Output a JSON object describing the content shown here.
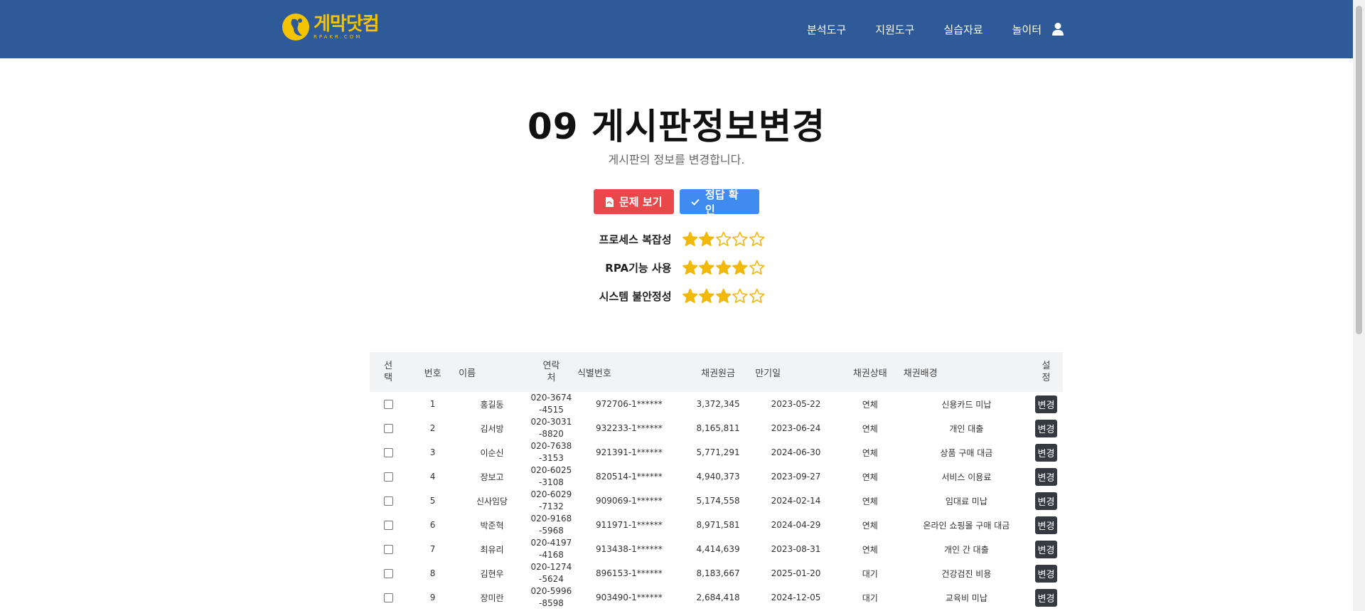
{
  "header": {
    "logo_main": "게막닷컴",
    "logo_sub": "RPAKR.COM",
    "nav": [
      "분석도구",
      "지원도구",
      "실습자료",
      "놀이터"
    ],
    "brand_color": "#2f5a98",
    "logo_color": "#f5c400",
    "user_icon": "user-icon"
  },
  "page": {
    "title": "09 게시판정보변경",
    "subtitle": "게시판의 정보를 변경합니다.",
    "btn_problem": "문제 보기",
    "btn_answer": "정답 확인",
    "btn_problem_color": "#e84849",
    "btn_answer_color": "#3f8bf0"
  },
  "ratings": [
    {
      "label": "프로세스 복잡성",
      "value": 2,
      "max": 5
    },
    {
      "label": "RPA기능 사용",
      "value": 4,
      "max": 5
    },
    {
      "label": "시스템 불안정성",
      "value": 3,
      "max": 5
    }
  ],
  "table": {
    "headers": {
      "select": "선택",
      "no": "번호",
      "name": "이름",
      "phone": "연락처",
      "id": "식별번호",
      "amount": "채권원금",
      "due": "만기일",
      "state": "채권상태",
      "bg": "채권배경",
      "setting": "설정"
    },
    "edit_label": "변경",
    "rows": [
      {
        "no": "1",
        "name": "홍길동",
        "phone": "020-3674-4515",
        "id": "972706-1******",
        "amount": "3,372,345",
        "due": "2023-05-22",
        "state": "연체",
        "bg": "신용카드 미납"
      },
      {
        "no": "2",
        "name": "김서방",
        "phone": "020-3031-8820",
        "id": "932233-1******",
        "amount": "8,165,811",
        "due": "2023-06-24",
        "state": "연체",
        "bg": "개인 대출"
      },
      {
        "no": "3",
        "name": "이순신",
        "phone": "020-7638-3153",
        "id": "921391-1******",
        "amount": "5,771,291",
        "due": "2024-06-30",
        "state": "연체",
        "bg": "상품 구매 대금"
      },
      {
        "no": "4",
        "name": "장보고",
        "phone": "020-6025-3108",
        "id": "820514-1******",
        "amount": "4,940,373",
        "due": "2023-09-27",
        "state": "연체",
        "bg": "서비스 이용료"
      },
      {
        "no": "5",
        "name": "신사임당",
        "phone": "020-6029-7132",
        "id": "909069-1******",
        "amount": "5,174,558",
        "due": "2024-02-14",
        "state": "연체",
        "bg": "임대료 미납"
      },
      {
        "no": "6",
        "name": "박준혁",
        "phone": "020-9168-5968",
        "id": "911971-1******",
        "amount": "8,971,581",
        "due": "2024-04-29",
        "state": "연체",
        "bg": "온라인 쇼핑몰 구매 대금"
      },
      {
        "no": "7",
        "name": "최유리",
        "phone": "020-4197-4168",
        "id": "913438-1******",
        "amount": "4,414,639",
        "due": "2023-08-31",
        "state": "연체",
        "bg": "개인 간 대출"
      },
      {
        "no": "8",
        "name": "김현우",
        "phone": "020-1274-5624",
        "id": "896153-1******",
        "amount": "8,183,667",
        "due": "2025-01-20",
        "state": "대기",
        "bg": "건강검진 비용"
      },
      {
        "no": "9",
        "name": "장미란",
        "phone": "020-5996-8598",
        "id": "903490-1******",
        "amount": "2,684,418",
        "due": "2024-12-05",
        "state": "대기",
        "bg": "교육비 미납"
      }
    ]
  },
  "colors": {
    "star_fill": "#f0b90b",
    "star_empty": "#f0b90b"
  }
}
